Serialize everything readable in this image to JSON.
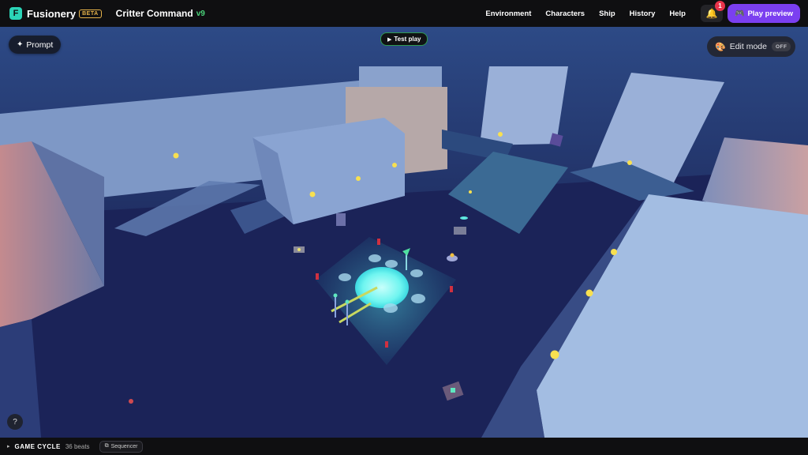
{
  "header": {
    "logo_letter": "F",
    "brand": "Fusionery",
    "beta_badge": "BETA",
    "project_title": "Critter Command",
    "project_version": "v9",
    "nav": [
      "Environment",
      "Characters",
      "Ship",
      "History",
      "Help"
    ],
    "notification_count": "1",
    "play_preview_label": "Play preview"
  },
  "overlay": {
    "prompt_label": "Prompt",
    "test_play_label": "Test play",
    "edit_mode_label": "Edit mode",
    "edit_mode_state": "OFF",
    "help_label": "?"
  },
  "footer": {
    "section_title": "GAME CYCLE",
    "beats": "36 beats",
    "sequencer_label": "Sequencer"
  },
  "icons": {
    "logo": "fusionery-logo-icon",
    "bell": "bell-icon",
    "play": "gamepad-icon",
    "prompt": "sparkle-icon",
    "test_play": "play-triangle-icon",
    "edit_mode": "palette-icon",
    "sequencer": "sequencer-icon"
  },
  "colors": {
    "accent_purple": "#7b3ff0",
    "brand_teal": "#2bd4b7",
    "version_green": "#4bd37a",
    "beta_gold": "#e6b24a",
    "badge_red": "#e8334a",
    "portal_cyan": "#6ff5f0"
  }
}
